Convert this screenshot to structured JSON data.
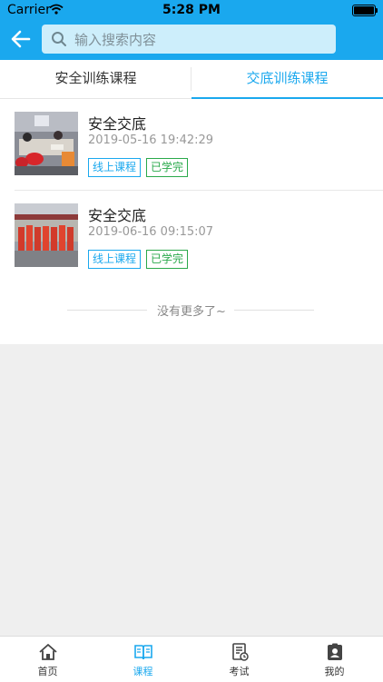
{
  "status_bar": {
    "carrier": "Carrier",
    "time": "5:28 PM"
  },
  "header": {
    "search_placeholder": "输入搜索内容"
  },
  "tabs": [
    {
      "label": "安全训练课程",
      "active": false
    },
    {
      "label": "交底训练课程",
      "active": true
    }
  ],
  "courses": [
    {
      "title": "安全交底",
      "datetime": "2019-05-16 19:42:29",
      "type_tag": "线上课程",
      "status_tag": "已学完"
    },
    {
      "title": "安全交底",
      "datetime": "2019-06-16 09:15:07",
      "type_tag": "线上课程",
      "status_tag": "已学完"
    }
  ],
  "list_footer": "没有更多了~",
  "bottom_nav": [
    {
      "label": "首页",
      "icon": "home-icon",
      "active": false
    },
    {
      "label": "课程",
      "icon": "book-icon",
      "active": true
    },
    {
      "label": "考试",
      "icon": "exam-icon",
      "active": false
    },
    {
      "label": "我的",
      "icon": "profile-icon",
      "active": false
    }
  ],
  "colors": {
    "accent": "#1aa8ee",
    "done_green": "#2aa94b",
    "page_bg": "#efefef"
  }
}
